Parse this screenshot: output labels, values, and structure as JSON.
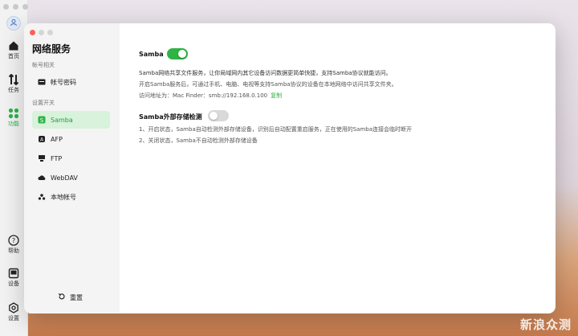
{
  "rail": {
    "items": [
      {
        "label": "首页",
        "icon": "home-icon"
      },
      {
        "label": "任务",
        "icon": "transfer-icon"
      },
      {
        "label": "功能",
        "icon": "apps-icon"
      },
      {
        "label": "帮助",
        "icon": "help-icon"
      },
      {
        "label": "设备",
        "icon": "device-icon"
      },
      {
        "label": "设置",
        "icon": "settings-icon"
      }
    ],
    "active_color": "#2db34a"
  },
  "sidebar": {
    "title": "网络服务",
    "section_account": "帐号相关",
    "account_item": "帐号密码",
    "section_settings": "设置开关",
    "items": [
      {
        "label": "Samba",
        "icon": "samba-icon"
      },
      {
        "label": "AFP",
        "icon": "apple-icon"
      },
      {
        "label": "FTP",
        "icon": "ftp-icon"
      },
      {
        "label": "WebDAV",
        "icon": "cloud-icon"
      },
      {
        "label": "本地帐号",
        "icon": "users-icon"
      }
    ],
    "reset_label": "重置"
  },
  "main": {
    "samba_label": "Samba",
    "samba_enabled": true,
    "desc1": "Samba网络共享文件服务，让你局域网内其它设备访问数据更简单快捷，支持Samba协议就能访问。",
    "desc2": "开启Samba服务后，可通过手机、电脑、电视等支持Samba协议的设备在本地网络中访问共享文件夹。",
    "address": "访问地址为：Mac Finder：smb://192.168.0.100",
    "copy_label": "复制",
    "ext_label": "Samba外部存储检测",
    "ext_enabled": false,
    "ext_note1": "1、开启状态，Samba自动检测外部存储设备，识别后自动配置重启服务，正在使用的Samba连接会临时断开",
    "ext_note2": "2、关闭状态，Samba不自动检测外部存储设备"
  },
  "watermark": "新浪众测",
  "colors": {
    "accent": "#2fb344",
    "active_bg": "#d8f2dc"
  }
}
